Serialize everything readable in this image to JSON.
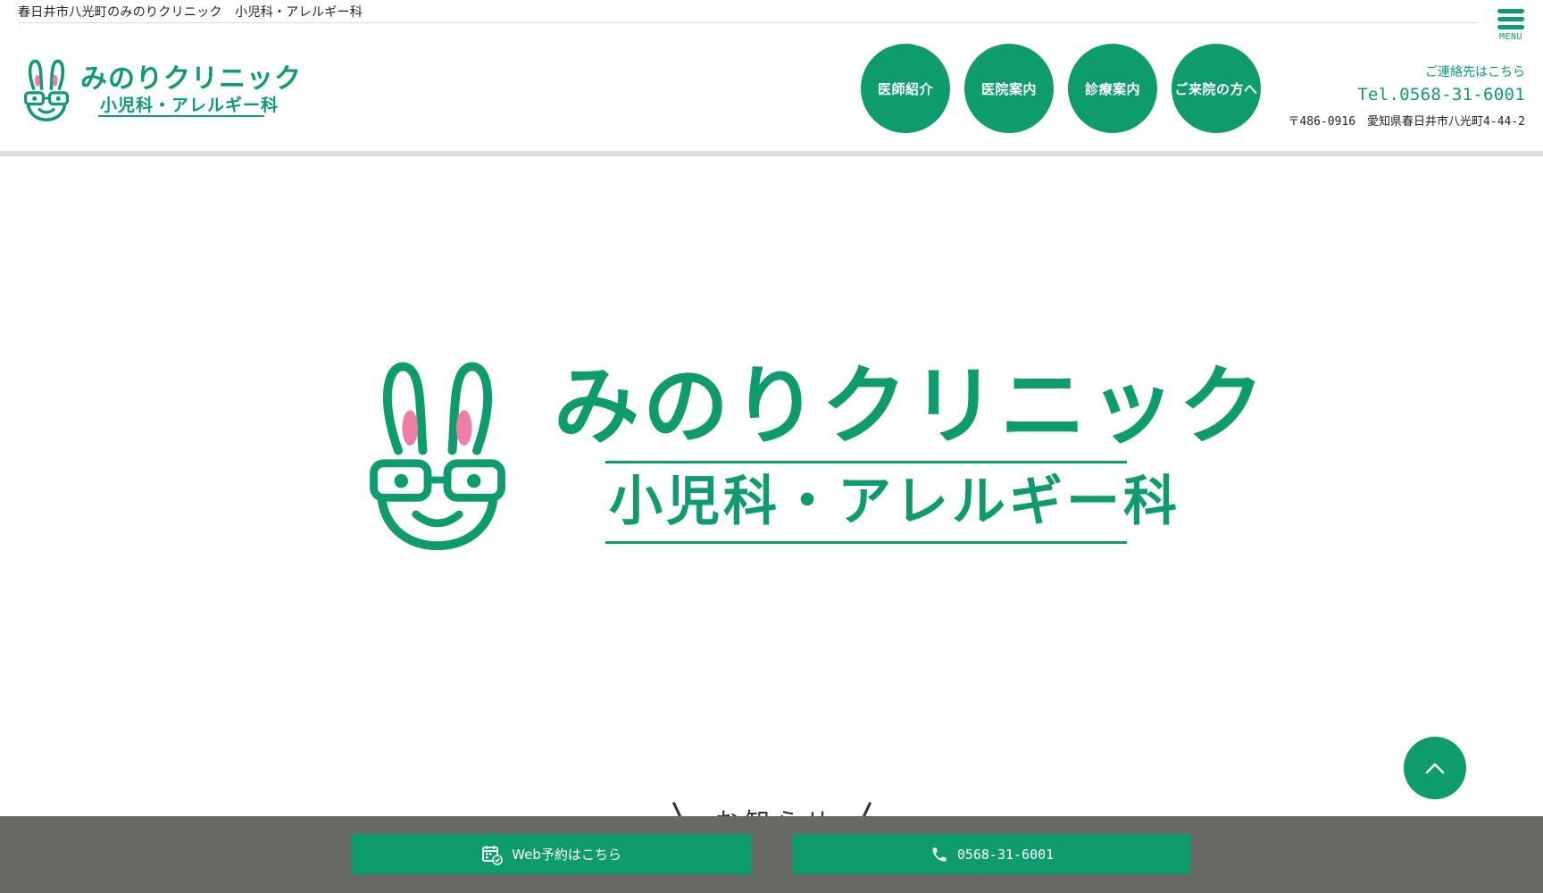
{
  "topbar": {
    "tagline": "春日井市八光町のみのりクリニック　小児科・アレルギー科"
  },
  "menu": {
    "label": "MENU"
  },
  "logo": {
    "title": "みのりクリニック",
    "subtitle": "小児科・アレルギー科"
  },
  "nav": {
    "items": [
      {
        "label": "医師紹介"
      },
      {
        "label": "医院案内"
      },
      {
        "label": "診療案内"
      },
      {
        "label": "ご来院の方へ"
      }
    ]
  },
  "contact": {
    "label": "ご連絡先はこちら",
    "tel": "Tel.0568-31-6001",
    "address": "〒486-0916　愛知県春日井市八光町4-44-2"
  },
  "hero": {
    "title": "みのりクリニック",
    "subtitle": "小児科・アレルギー科"
  },
  "news": {
    "heading": "お知らせ"
  },
  "footer_bar": {
    "web_label": "Web予約はこちら",
    "tel_label": "0568-31-6001"
  },
  "colors": {
    "brand_green": "#0f9c6c",
    "rabbit_ear_pink": "#ee7ea7",
    "bottom_bar_gray": "#666964"
  }
}
